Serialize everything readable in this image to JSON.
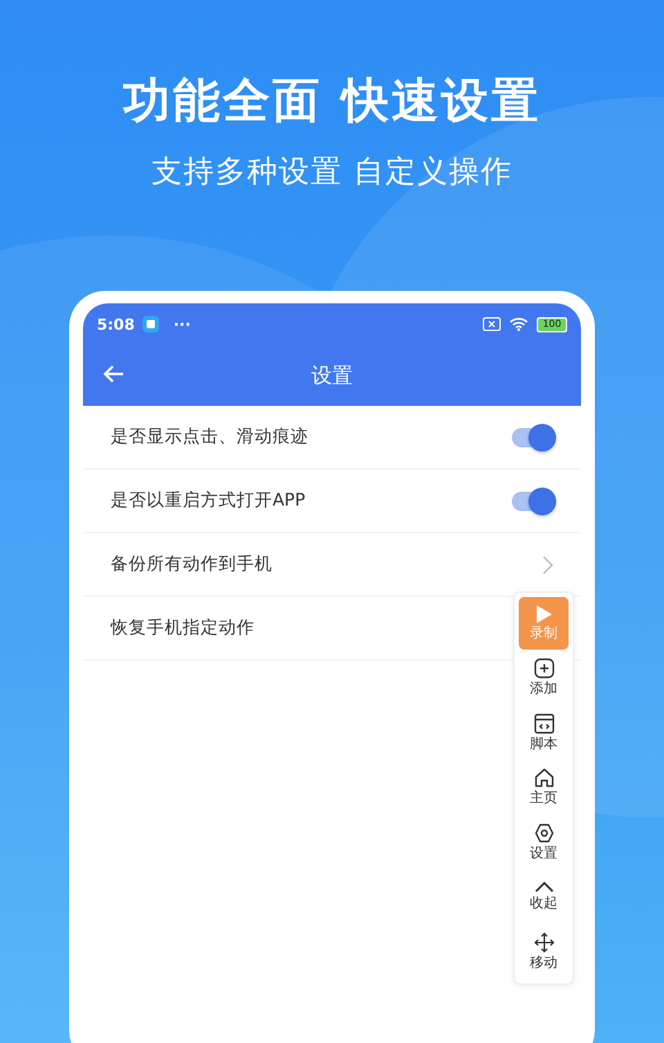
{
  "headline": "功能全面 快速设置",
  "subheadline": "支持多种设置 自定义操作",
  "status_bar": {
    "time": "5:08",
    "dots": "···",
    "battery": "100"
  },
  "app_bar": {
    "title": "设置"
  },
  "settings": [
    {
      "kind": "toggle",
      "label": "是否显示点击、滑动痕迹",
      "on": true
    },
    {
      "kind": "toggle",
      "label": "是否以重启方式打开APP",
      "on": true
    },
    {
      "kind": "link",
      "label": "备份所有动作到手机"
    },
    {
      "kind": "plain",
      "label": "恢复手机指定动作"
    }
  ],
  "toolbar": [
    {
      "kind": "play",
      "label": "录制",
      "selected": true
    },
    {
      "kind": "add",
      "label": "添加",
      "selected": false
    },
    {
      "kind": "script",
      "label": "脚本",
      "selected": false
    },
    {
      "kind": "home",
      "label": "主页",
      "selected": false
    },
    {
      "kind": "settings",
      "label": "设置",
      "selected": false
    },
    {
      "kind": "collapse",
      "label": "收起",
      "selected": false
    },
    {
      "kind": "move",
      "label": "移动",
      "selected": false
    }
  ]
}
